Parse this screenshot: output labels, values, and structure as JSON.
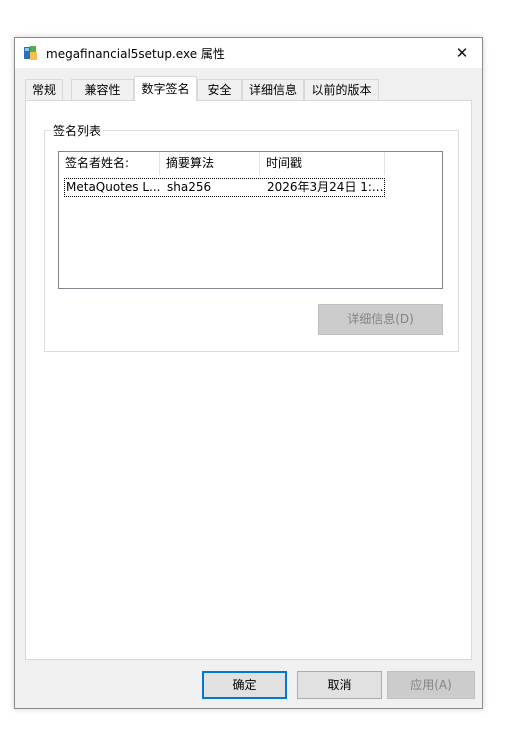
{
  "window": {
    "title": "megafinancial5setup.exe 属性",
    "close_symbol": "✕"
  },
  "tabs": [
    {
      "label": "常规"
    },
    {
      "label": "兼容性"
    },
    {
      "label": "数字签名",
      "active": true
    },
    {
      "label": "安全"
    },
    {
      "label": "详细信息"
    },
    {
      "label": "以前的版本"
    }
  ],
  "signature_group": {
    "title": "签名列表",
    "columns": [
      "签名者姓名:",
      "摘要算法",
      "时间戳"
    ],
    "rows": [
      {
        "signer": "MetaQuotes L...",
        "algorithm": "sha256",
        "timestamp": "2026年3月24日 1:..."
      }
    ],
    "details_button": "详细信息(D)"
  },
  "footer": {
    "ok": "确定",
    "cancel": "取消",
    "apply": "应用(A)"
  },
  "icons": {
    "app": "installer-icon",
    "close": "close-icon"
  },
  "colors": {
    "accent": "#0078d7",
    "window_bg": "#f0f0f0",
    "disabled_text": "#838383"
  }
}
